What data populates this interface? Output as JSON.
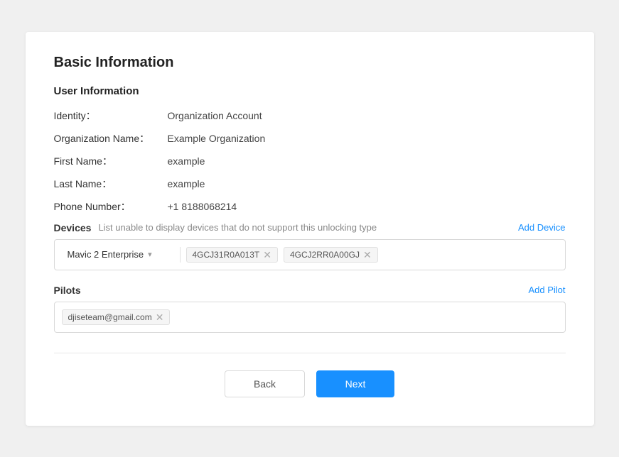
{
  "card": {
    "section_title": "Basic Information",
    "user_info": {
      "subsection_title": "User Information",
      "fields": [
        {
          "label": "Identity：",
          "value": "Organization Account"
        },
        {
          "label": "Organization Name：",
          "value": "Example Organization"
        },
        {
          "label": "First Name：",
          "value": "example"
        },
        {
          "label": "Last Name：",
          "value": "example"
        },
        {
          "label": "Phone Number：",
          "value": "+1 8188068214"
        }
      ]
    },
    "devices": {
      "label": "Devices",
      "hint": "List unable to display devices that do not support this unlocking type",
      "add_label": "Add Device",
      "dropdown_value": "Mavic 2 Enterprise",
      "tags": [
        {
          "id": "4GCJ31R0A013T"
        },
        {
          "id": "4GCJ2RR0A00GJ"
        }
      ]
    },
    "pilots": {
      "label": "Pilots",
      "add_label": "Add Pilot",
      "tags": [
        {
          "email": "djiseteam@gmail.com"
        }
      ]
    },
    "footer": {
      "back_label": "Back",
      "next_label": "Next"
    }
  }
}
